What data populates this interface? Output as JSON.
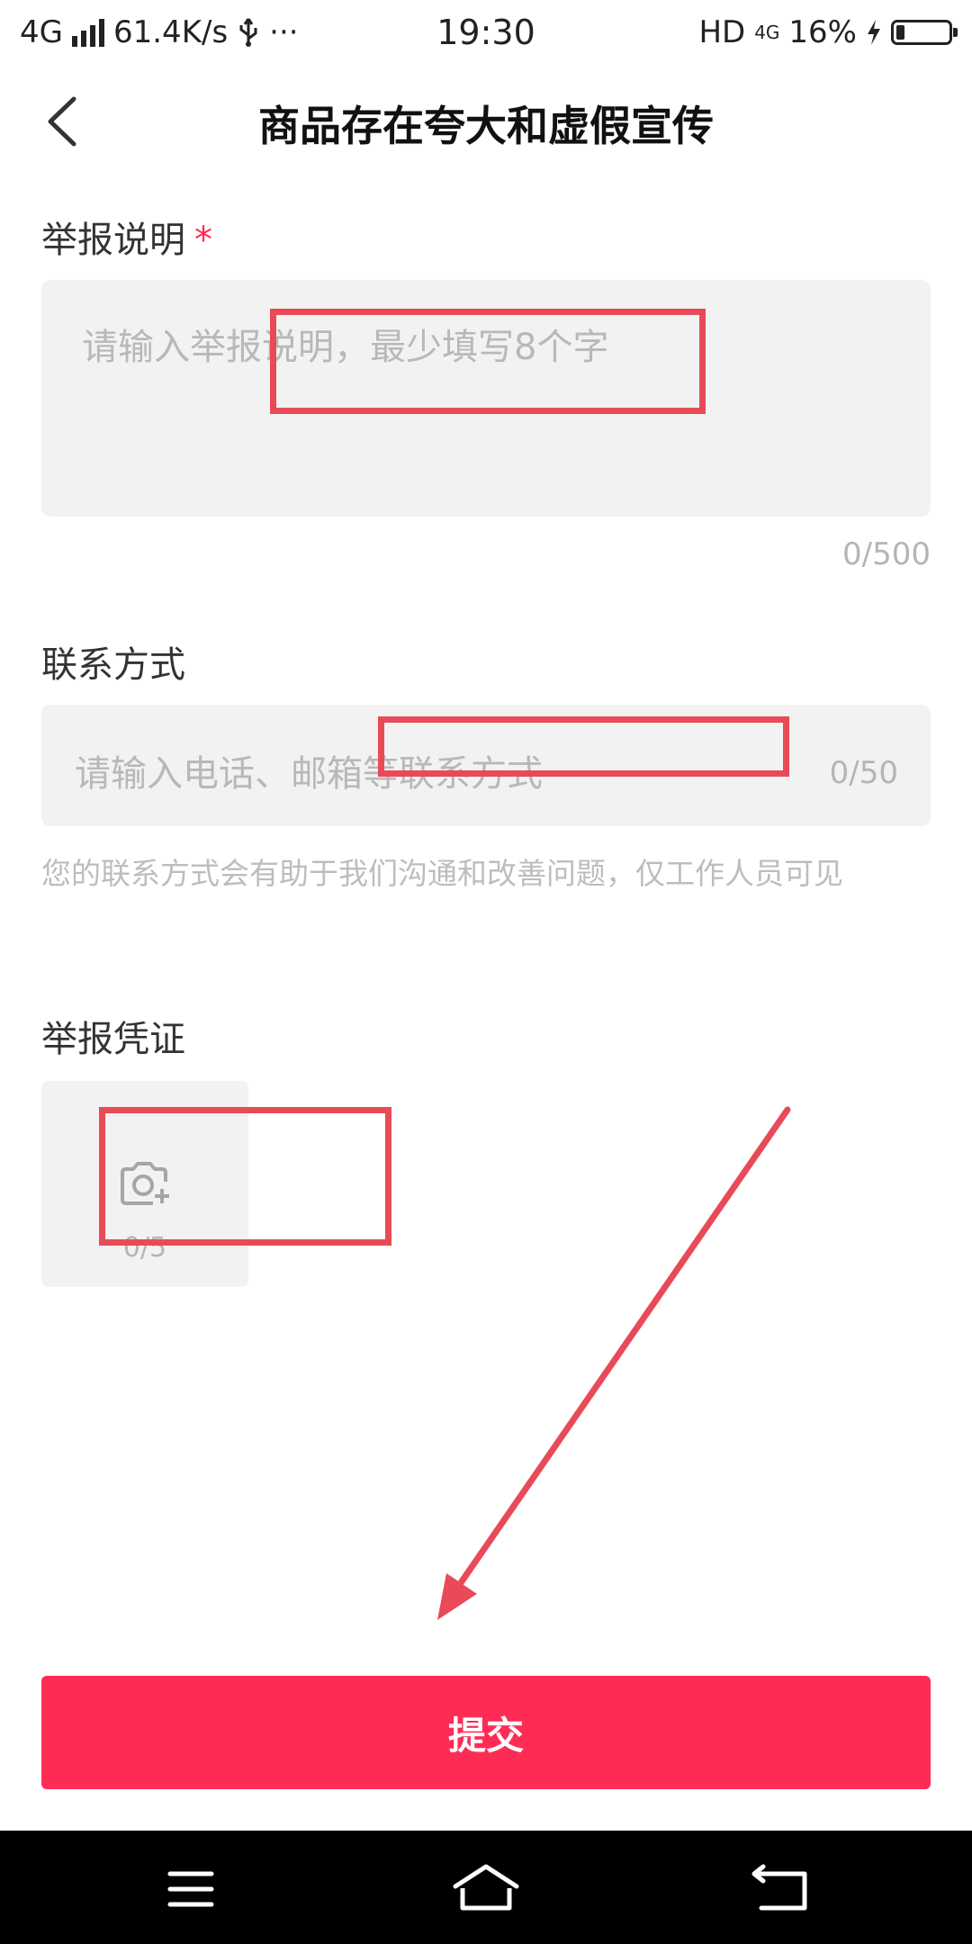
{
  "status_bar": {
    "network": "4G",
    "speed": "61.4K/s",
    "usb_icon": "usb-icon",
    "more": "···",
    "time": "19:30",
    "hd": "HD",
    "network_small": "4G",
    "battery_percent": "16%",
    "battery_level": 0.16
  },
  "header": {
    "title": "商品存在夸大和虚假宣传"
  },
  "report_description": {
    "label": "举报说明",
    "required_mark": "*",
    "placeholder": "请输入举报说明，最少填写8个字",
    "counter": "0/500"
  },
  "contact": {
    "label": "联系方式",
    "placeholder": "请输入电话、邮箱等联系方式",
    "counter": "0/50",
    "hint": "您的联系方式会有助于我们沟通和改善问题，仅工作人员可见"
  },
  "evidence": {
    "label": "举报凭证",
    "count": "0/5",
    "icon": "camera-add-icon"
  },
  "submit": {
    "label": "提交"
  },
  "colors": {
    "accent": "#fe2c55",
    "annotation": "#e84a57",
    "input_bg": "#f2f2f2",
    "placeholder": "#b8b8b8"
  }
}
